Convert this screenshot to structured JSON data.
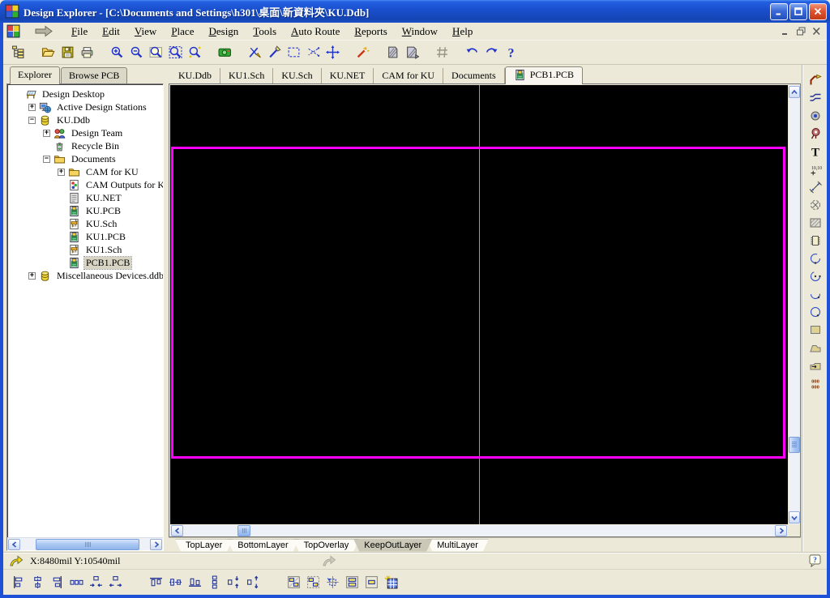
{
  "window": {
    "title": "Design Explorer - [C:\\Documents and Settings\\h301\\桌面\\新資料夾\\KU.Ddb]",
    "controls": [
      "minimize",
      "maximize",
      "close"
    ],
    "mdi_controls": [
      "minimize",
      "restore",
      "close"
    ]
  },
  "menu": {
    "items": [
      {
        "label": "File",
        "underline": 0
      },
      {
        "label": "Edit",
        "underline": 0
      },
      {
        "label": "View",
        "underline": 0
      },
      {
        "label": "Place",
        "underline": 0
      },
      {
        "label": "Design",
        "underline": 0
      },
      {
        "label": "Tools",
        "underline": 0
      },
      {
        "label": "Auto Route",
        "underline": 0
      },
      {
        "label": "Reports",
        "underline": 0
      },
      {
        "label": "Window",
        "underline": 0
      },
      {
        "label": "Help",
        "underline": 0
      }
    ]
  },
  "main_toolbar": {
    "groups": [
      [
        "explorer-panel"
      ],
      [
        "open-document",
        "save",
        "print"
      ],
      [
        "zoom-in",
        "zoom-out",
        "zoom-area",
        "zoom-document",
        "zoom-selection"
      ],
      [
        "capture"
      ],
      [
        "knife",
        "slice-tracks",
        "select-area",
        "deselect",
        "move-selection"
      ],
      [
        "wizard"
      ],
      [
        "hatched-shield",
        "hatched-shield-flip"
      ],
      [
        "toggle-grid"
      ],
      [
        "undo",
        "redo",
        "help"
      ]
    ]
  },
  "explorer_panel": {
    "tabs": [
      {
        "label": "Explorer",
        "active": true
      },
      {
        "label": "Browse PCB",
        "active": false
      }
    ],
    "tree": [
      {
        "label": "Design Desktop",
        "icon": "design-desktop",
        "level": 0,
        "expand": null,
        "selected": false
      },
      {
        "label": "Active Design Stations",
        "icon": "design-station",
        "level": 1,
        "expand": "plus",
        "selected": false
      },
      {
        "label": "KU.Ddb",
        "icon": "database",
        "level": 1,
        "expand": "minus",
        "selected": false
      },
      {
        "label": "Design Team",
        "icon": "design-team",
        "level": 2,
        "expand": "plus",
        "selected": false
      },
      {
        "label": "Recycle Bin",
        "icon": "recycle-bin",
        "level": 2,
        "expand": null,
        "selected": false
      },
      {
        "label": "Documents",
        "icon": "folder",
        "level": 2,
        "expand": "minus",
        "selected": false
      },
      {
        "label": "CAM for KU",
        "icon": "folder",
        "level": 3,
        "expand": "plus",
        "selected": false
      },
      {
        "label": "CAM Outputs for KU",
        "icon": "cam-doc",
        "level": 3,
        "expand": null,
        "selected": false
      },
      {
        "label": "KU.NET",
        "icon": "net-doc",
        "level": 3,
        "expand": null,
        "selected": false
      },
      {
        "label": "KU.PCB",
        "icon": "pcb-doc",
        "level": 3,
        "expand": null,
        "selected": false
      },
      {
        "label": "KU.Sch",
        "icon": "sch-doc",
        "level": 3,
        "expand": null,
        "selected": false
      },
      {
        "label": "KU1.PCB",
        "icon": "pcb-doc",
        "level": 3,
        "expand": null,
        "selected": false
      },
      {
        "label": "KU1.Sch",
        "icon": "sch-doc",
        "level": 3,
        "expand": null,
        "selected": false
      },
      {
        "label": "PCB1.PCB",
        "icon": "pcb-doc",
        "level": 3,
        "expand": null,
        "selected": true
      },
      {
        "label": "Miscellaneous Devices.ddb",
        "icon": "database",
        "level": 1,
        "expand": "plus",
        "selected": false
      }
    ]
  },
  "document_tabs": {
    "tabs": [
      {
        "label": "KU.Ddb",
        "active": false
      },
      {
        "label": "KU1.Sch",
        "active": false
      },
      {
        "label": "KU.Sch",
        "active": false
      },
      {
        "label": "KU.NET",
        "active": false
      },
      {
        "label": "CAM for KU",
        "active": false
      },
      {
        "label": "Documents",
        "active": false
      },
      {
        "label": "PCB1.PCB",
        "active": true,
        "icon": "pcb-doc"
      }
    ]
  },
  "editor": {
    "background_color": "#000000",
    "board_outline_color": "#FF00FF",
    "grid_line_color": "#9a9a9a"
  },
  "layer_tabs": {
    "tabs": [
      "TopLayer",
      "BottomLayer",
      "TopOverlay",
      "KeepOutLayer",
      "MultiLayer"
    ],
    "active_index": 3
  },
  "placement_toolbar": {
    "items": [
      "interactive-routing",
      "multiple-traces",
      "pad",
      "via",
      "string",
      "coordinate",
      "dimension",
      "origin",
      "room",
      "component",
      "arc-edge",
      "arc-center",
      "arc-angle",
      "full-circle",
      "fill",
      "polygon-plane",
      "split-plane",
      "array-paste"
    ]
  },
  "status": {
    "coords": "X:8480mil Y:10540mil"
  },
  "alignment_toolbar": {
    "groups": [
      [
        "align-left",
        "align-h-centers",
        "align-right",
        "space-equal-h",
        "decrease-h-space",
        "increase-h-space"
      ],
      [
        "align-top",
        "align-v-centers",
        "align-bottom",
        "space-equal-v",
        "decrease-v-space",
        "increase-v-space"
      ],
      [
        "arrange-in-room",
        "arrange-outside-board",
        "align-to-grid",
        "component-text-position",
        "component-position",
        "paste-array"
      ]
    ]
  }
}
